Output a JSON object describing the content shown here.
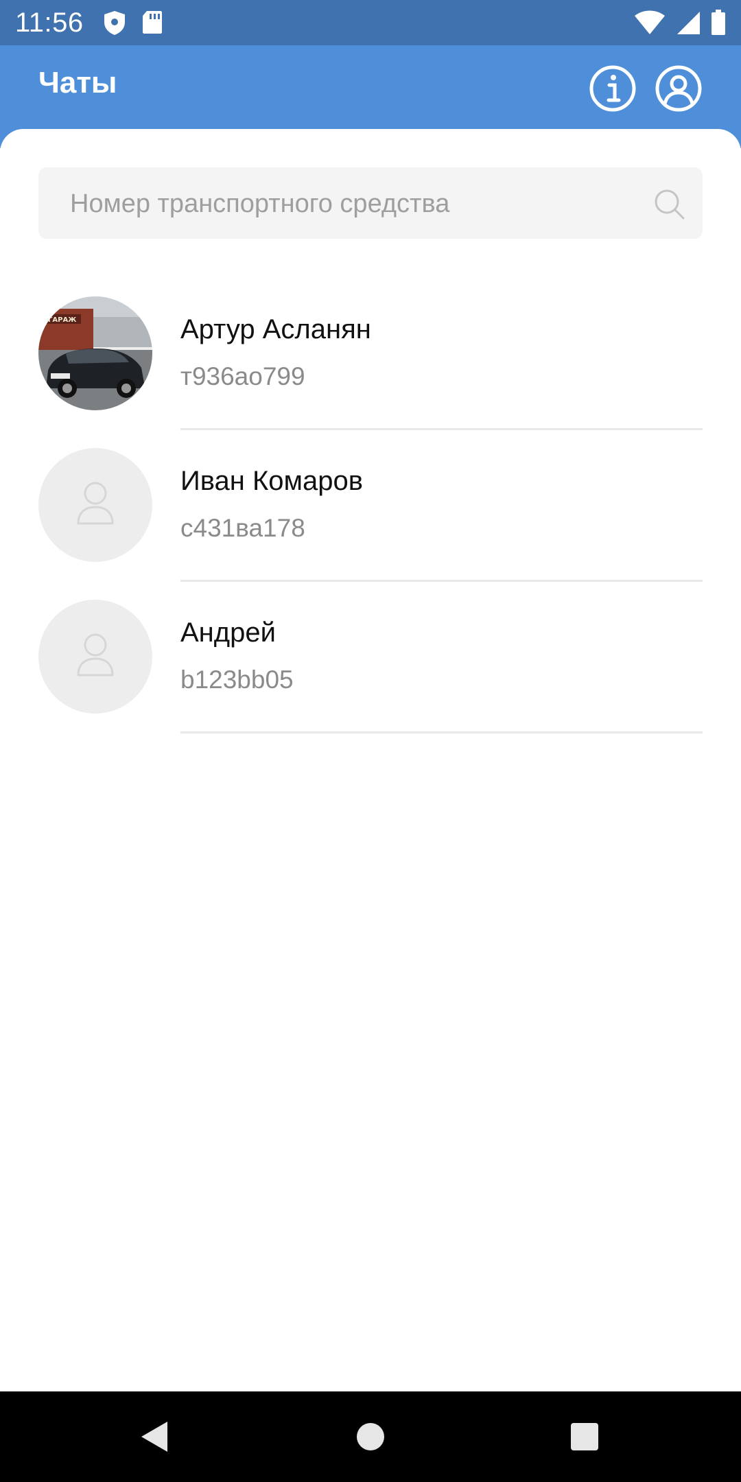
{
  "status_bar": {
    "time": "11:56",
    "left_icons": [
      "shield-icon",
      "sd-card-icon"
    ],
    "right_icons": [
      "wifi-icon",
      "cell-signal-icon",
      "battery-icon"
    ]
  },
  "header": {
    "title": "Чаты",
    "actions": [
      "info-icon",
      "profile-icon"
    ],
    "color": "#4f8fda"
  },
  "search": {
    "placeholder": "Номер транспортного средства",
    "value": ""
  },
  "chats": [
    {
      "name": "Артур Асланян",
      "plate": "т936ао799",
      "avatar": "car-photo"
    },
    {
      "name": "Иван Комаров",
      "plate": "с431ва178",
      "avatar": "placeholder"
    },
    {
      "name": "Андрей",
      "plate": "b123bb05",
      "avatar": "placeholder"
    }
  ],
  "nav_bar": [
    "back",
    "home",
    "recents"
  ]
}
